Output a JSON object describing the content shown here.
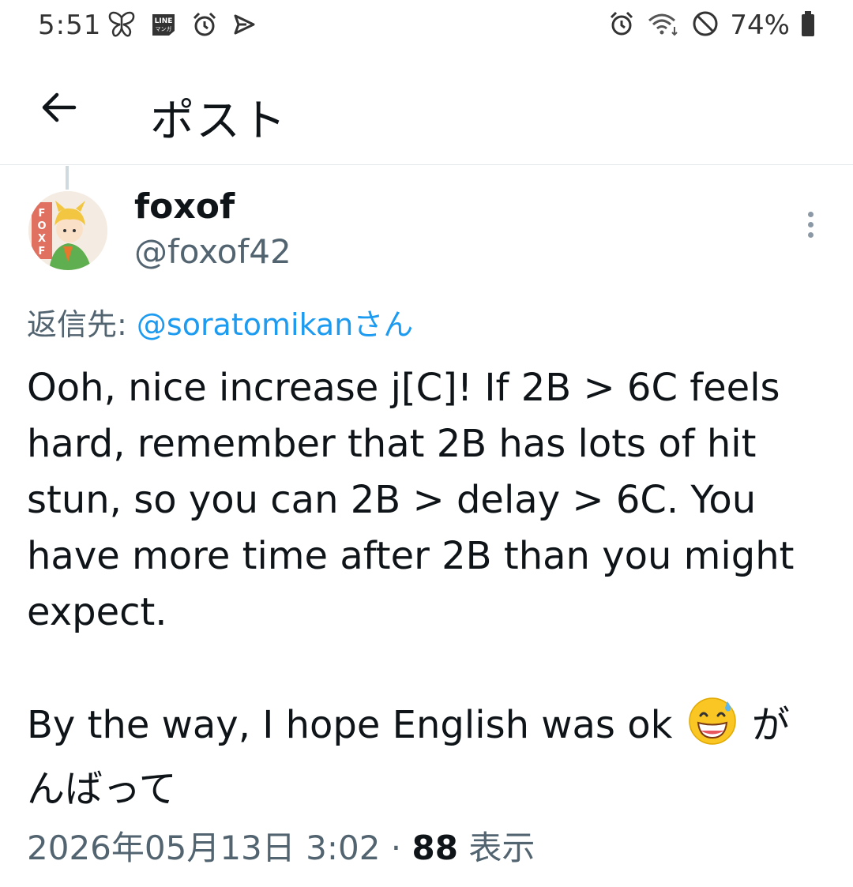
{
  "status_bar": {
    "time": "5:51",
    "battery": "74%",
    "left_icons": [
      "butterfly-icon",
      "line-manga-icon",
      "alarm-icon",
      "send-icon"
    ],
    "right_icons": [
      "alarm-icon",
      "wifi-icon",
      "do-not-disturb-icon",
      "battery-icon"
    ],
    "line_manga_label": "LINE\nマンガ"
  },
  "header": {
    "title": "ポスト",
    "back_icon": "arrow-left-icon"
  },
  "post": {
    "author_name": "foxof",
    "author_handle": "@foxof42",
    "avatar_text": "FOXOF",
    "reply_prefix": "返信先: ",
    "reply_mention": "@soratomikanさん",
    "body_para1": "Ooh, nice increase j[C]! If 2B > 6C feels hard, remember that 2B has lots of hit stun, so you can 2B > delay > 6C. You have more time after 2B than you might expect.",
    "body_para2_before": "By the way, I hope English was ok ",
    "body_emoji": "grinning-face-with-sweat-emoji",
    "body_para2_after": " がんばって",
    "timestamp": "2026年05月13日 3:02",
    "separator": " · ",
    "views_count": "88",
    "views_label": " 表示"
  },
  "colors": {
    "text": "#0f1419",
    "secondary": "#536471",
    "link": "#1d9bf0",
    "divider": "#e6e9eb"
  }
}
